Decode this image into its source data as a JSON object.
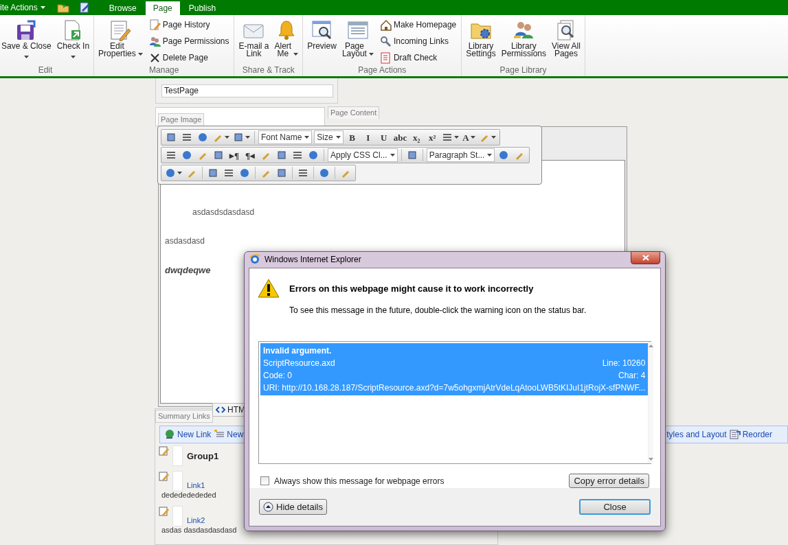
{
  "top_bar": {
    "site_actions": "ite Actions",
    "tabs": [
      {
        "label": "Browse",
        "selected": false
      },
      {
        "label": "Page",
        "selected": true
      },
      {
        "label": "Publish",
        "selected": false
      }
    ]
  },
  "ribbon": {
    "groups": [
      {
        "label": "Edit",
        "large": [
          {
            "lines": [
              "Save & Close"
            ],
            "kind": "split"
          },
          {
            "lines": [
              "Check In"
            ],
            "kind": "split"
          }
        ]
      },
      {
        "label": "Manage",
        "large": [
          {
            "lines": [
              "Edit",
              "Properties"
            ],
            "kind": "menu"
          }
        ],
        "small": [
          "Page History",
          "Page Permissions",
          "Delete Page"
        ]
      },
      {
        "label": "Share & Track",
        "large": [
          {
            "lines": [
              "E-mail a",
              "Link"
            ],
            "kind": "plain"
          },
          {
            "lines": [
              "Alert",
              "Me"
            ],
            "kind": "menu"
          }
        ]
      },
      {
        "label": "Page Actions",
        "large": [
          {
            "lines": [
              "Preview"
            ],
            "kind": "plain"
          },
          {
            "lines": [
              "Page",
              "Layout"
            ],
            "kind": "menu"
          }
        ],
        "small": [
          "Make Homepage",
          "Incoming Links",
          "Draft Check"
        ]
      },
      {
        "label": "Page Library",
        "large": [
          {
            "lines": [
              "Library",
              "Settings"
            ],
            "kind": "plain"
          },
          {
            "lines": [
              "Library",
              "Permissions"
            ],
            "kind": "plain"
          },
          {
            "lines": [
              "View All",
              "Pages"
            ],
            "kind": "plain"
          }
        ]
      }
    ]
  },
  "title_field": {
    "value": "TestPage"
  },
  "field_tabs": [
    {
      "label": "Page Image"
    },
    {
      "label": "Page Content"
    }
  ],
  "editor_toolbar": {
    "rows": [
      {
        "items": [
          {
            "kind": "icon"
          },
          {
            "kind": "icon"
          },
          {
            "kind": "icon"
          },
          {
            "kind": "icon",
            "menu": true
          },
          {
            "kind": "icon",
            "menu": true
          },
          {
            "kind": "dropdown",
            "text": "Font Name",
            "sep_before": true
          },
          {
            "kind": "dropdown",
            "text": "Size"
          },
          {
            "kind": "glyph",
            "text": "B"
          },
          {
            "kind": "glyph",
            "text": "I"
          },
          {
            "kind": "glyph",
            "text": "U"
          },
          {
            "kind": "glyph",
            "text": "abc"
          },
          {
            "kind": "glyph",
            "text": "x₂"
          },
          {
            "kind": "glyph",
            "text": "x²"
          },
          {
            "kind": "icon",
            "menu": true
          },
          {
            "kind": "glyph",
            "text": "A",
            "menu": true
          },
          {
            "kind": "icon",
            "menu": true
          }
        ]
      },
      {
        "items": [
          {
            "kind": "icon"
          },
          {
            "kind": "icon"
          },
          {
            "kind": "icon"
          },
          {
            "kind": "icon"
          },
          {
            "kind": "glyph",
            "text": "▸¶"
          },
          {
            "kind": "glyph",
            "text": "¶◂"
          },
          {
            "kind": "icon"
          },
          {
            "kind": "icon"
          },
          {
            "kind": "icon"
          },
          {
            "kind": "icon"
          },
          {
            "kind": "dropdown",
            "text": "Apply CSS Cl...",
            "sep_before": true
          },
          {
            "kind": "icon",
            "sep_before": true
          },
          {
            "kind": "dropdown",
            "text": "Paragraph St...",
            "sep_before": true
          },
          {
            "kind": "icon"
          },
          {
            "kind": "icon"
          }
        ]
      },
      {
        "items": [
          {
            "kind": "icon",
            "menu": true
          },
          {
            "kind": "icon"
          },
          {
            "kind": "icon",
            "sep_before": true
          },
          {
            "kind": "icon"
          },
          {
            "kind": "icon"
          },
          {
            "kind": "icon",
            "sep_before": true
          },
          {
            "kind": "icon"
          },
          {
            "kind": "icon",
            "sep_before": true
          },
          {
            "kind": "icon",
            "sep_before": true
          },
          {
            "kind": "icon",
            "sep_before": true
          }
        ]
      }
    ]
  },
  "content": [
    {
      "kind": "indented",
      "text": "asdasdsdasdasd"
    },
    {
      "kind": "plain",
      "text": "asdasdasd"
    },
    {
      "kind": "emphasis",
      "text": "dwqdeqwe"
    }
  ],
  "mode_tabs": [
    {
      "label": "HTM"
    }
  ],
  "summary_links": {
    "tab": "Summary Links",
    "actions": [
      "New Link",
      "New"
    ],
    "right_actions": [
      "tyles and Layout",
      "Reorder"
    ],
    "items": [
      {
        "kind": "group",
        "title": "Group1"
      },
      {
        "kind": "link",
        "title": "Link1",
        "description": "dedededededed"
      },
      {
        "kind": "link",
        "title": "Link2",
        "description": "asdas dasdasdasdasd"
      }
    ]
  },
  "dialog": {
    "title": "Windows Internet Explorer",
    "heading": "Errors on this webpage might cause it to work incorrectly",
    "message": "To see this message in the future, double-click the warning icon on the status bar.",
    "errors": [
      {
        "selected": true,
        "title": "Invalid argument.",
        "rows": [
          {
            "left": "ScriptResource.axd",
            "right": "Line: 10260"
          },
          {
            "left": "Code: 0",
            "right": "Char: 4"
          },
          {
            "left": "URI: http://10.168.28.187/ScriptResource.axd?d=7w5ohgxmjAtrVdeLqAtooLWB5tKIJuI1jtRojX-sfPNWF..."
          }
        ]
      }
    ],
    "checkbox": {
      "label": "Always show this message for webpage errors",
      "checked": false
    },
    "copy_button": "Copy error details",
    "buttons": [
      {
        "kind": "toggle",
        "label": "Hide details",
        "focused": false
      },
      {
        "kind": "close",
        "label": "Close",
        "focused": true
      }
    ]
  }
}
